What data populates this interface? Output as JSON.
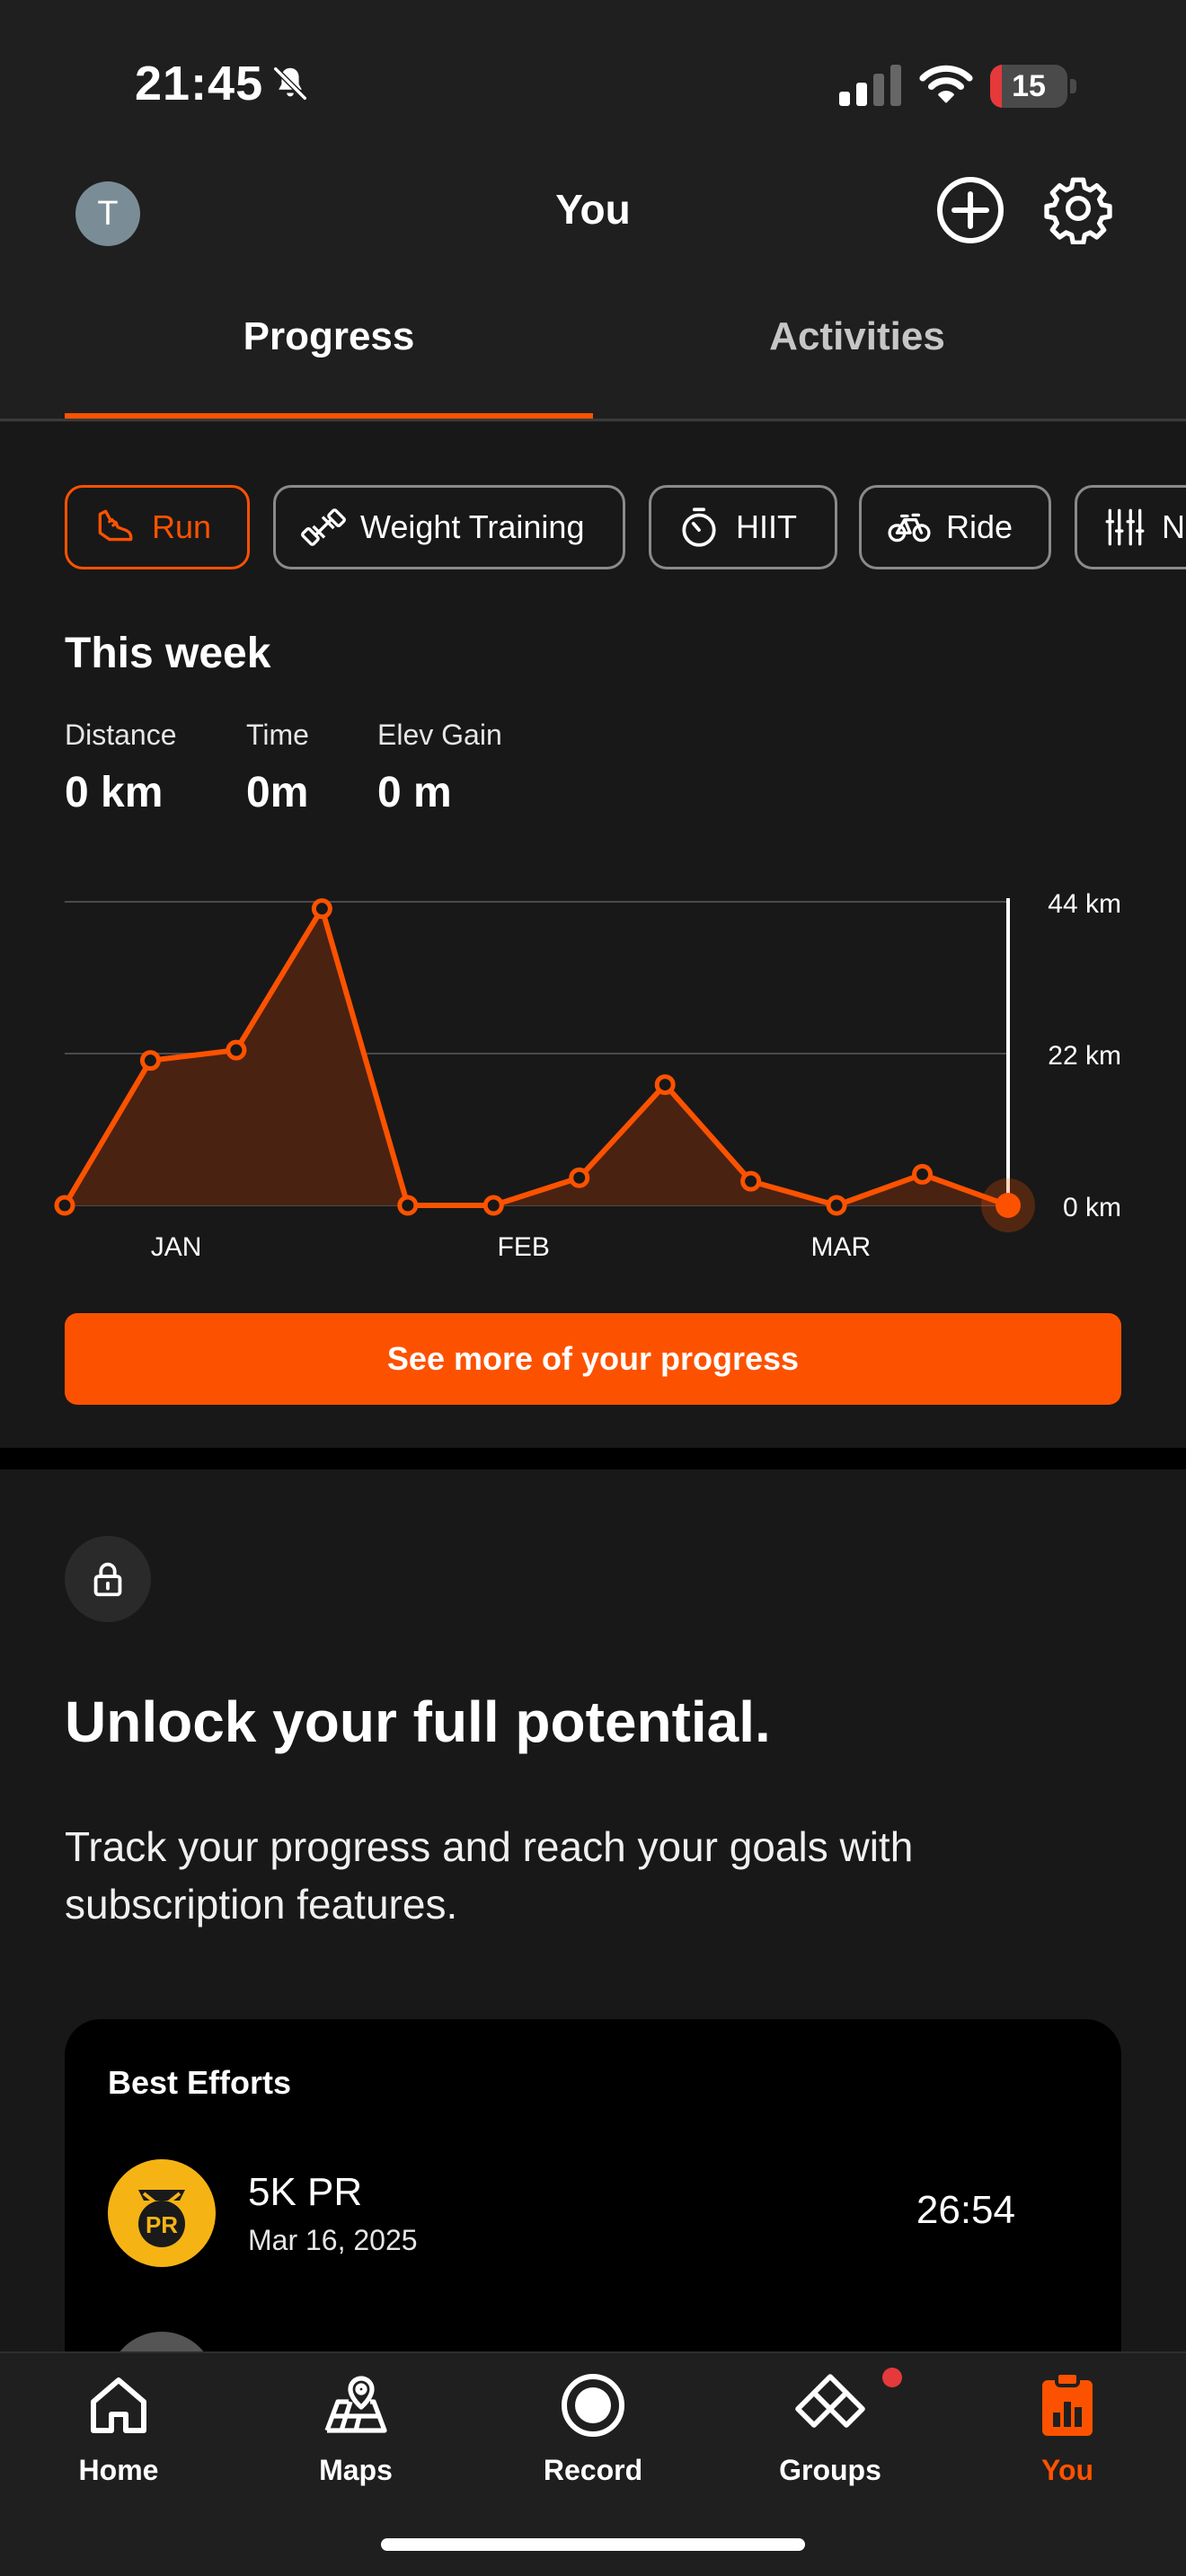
{
  "status_bar": {
    "time": "21:45",
    "battery": "15",
    "battery_level": 0.15,
    "icons": [
      "bell-slash-icon",
      "cellular-signal-icon",
      "wifi-icon",
      "battery-icon"
    ]
  },
  "header": {
    "avatar_initial": "T",
    "title": "You",
    "icons": [
      "plus-circle-icon",
      "gear-icon"
    ]
  },
  "tabs": [
    {
      "label": "Progress",
      "active": true
    },
    {
      "label": "Activities",
      "active": false
    }
  ],
  "sport_chips": [
    {
      "label": "Run",
      "icon": "running-shoe-icon",
      "active": true
    },
    {
      "label": "Weight Training",
      "icon": "dumbbell-icon",
      "active": false
    },
    {
      "label": "HIIT",
      "icon": "stopwatch-icon",
      "active": false
    },
    {
      "label": "Ride",
      "icon": "bike-icon",
      "active": false
    },
    {
      "label": "N",
      "icon": "ski-icon",
      "active": false
    }
  ],
  "week": {
    "title": "This week",
    "stats": [
      {
        "label": "Distance",
        "value": "0 km"
      },
      {
        "label": "Time",
        "value": "0m"
      },
      {
        "label": "Elev Gain",
        "value": "0 m"
      }
    ]
  },
  "chart_data": {
    "type": "area",
    "x": [
      1,
      2,
      3,
      4,
      5,
      6,
      7,
      8,
      9,
      10,
      11,
      12
    ],
    "values": [
      0,
      21,
      22.5,
      43,
      0,
      0,
      4,
      17.5,
      3.5,
      0,
      4.5,
      0
    ],
    "ylim": [
      0,
      44
    ],
    "y_ticks": [
      "44 km",
      "22 km",
      "0 km"
    ],
    "x_ticks": [
      {
        "label": "JAN",
        "at": 2.3
      },
      {
        "label": "FEB",
        "at": 6.35
      },
      {
        "label": "MAR",
        "at": 10.05
      }
    ],
    "highlight_index": 11,
    "grid": true,
    "colors": {
      "line": "#fc5200",
      "fill": "#4a2212",
      "grid": "#4a4a4a",
      "cursor": "#ffffff"
    }
  },
  "progress_button": "See more of your progress",
  "unlock": {
    "icon": "lock-icon",
    "title": "Unlock your full potential.",
    "text": "Track your progress and reach your goals with subscription features."
  },
  "best_efforts": {
    "title": "Best Efforts",
    "items": [
      {
        "icon": "pr-medal-icon",
        "badge_text": "PR",
        "name": "5K PR",
        "date": "Mar 16, 2025",
        "time": "26:54"
      }
    ]
  },
  "bottom_nav": [
    {
      "label": "Home",
      "icon": "home-icon",
      "active": false
    },
    {
      "label": "Maps",
      "icon": "map-icon",
      "active": false
    },
    {
      "label": "Record",
      "icon": "record-icon",
      "active": false
    },
    {
      "label": "Groups",
      "icon": "groups-icon",
      "active": false,
      "badge": true
    },
    {
      "label": "You",
      "icon": "clipboard-chart-icon",
      "active": true
    }
  ],
  "colors": {
    "accent": "#fc5200",
    "background": "#181818",
    "header": "#1f1f1f",
    "badge": "#e5393b",
    "pr_gold": "#f5b414"
  }
}
